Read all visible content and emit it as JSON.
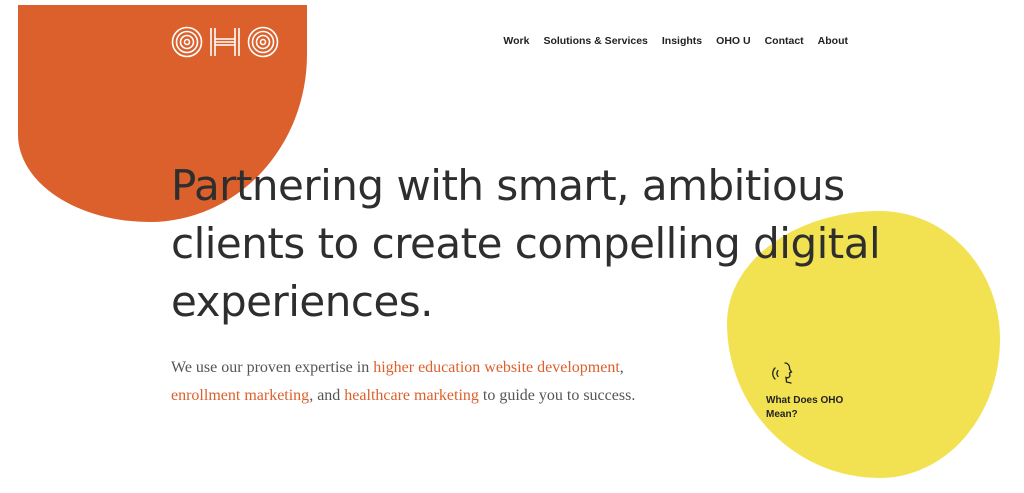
{
  "brand": {
    "logo_text": "OHO",
    "accent_orange": "#dc602c",
    "accent_yellow": "#f2e251"
  },
  "nav": {
    "items": [
      "Work",
      "Solutions & Services",
      "Insights",
      "OHO U",
      "Contact",
      "About"
    ]
  },
  "hero": {
    "headline": "Partnering with smart, ambitious clients to create compelling digital experiences.",
    "intro": {
      "part1": "We use our proven expertise in ",
      "link1": "higher education website development",
      "part2": ", ",
      "link2": "enrollment marketing",
      "part3": ", and ",
      "link3": "healthcare marketing",
      "part4": " to guide you to success."
    }
  },
  "oho_meaning": {
    "label": "What Does OHO Mean?",
    "icon": "speaking-head-icon"
  }
}
